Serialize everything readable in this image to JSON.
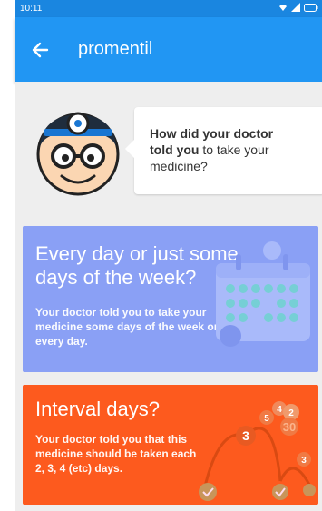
{
  "status_bar": {
    "time": "10:11"
  },
  "app_bar": {
    "title": "promentil",
    "back_icon": "arrow-back-icon"
  },
  "bubble": {
    "part1": "How did your doctor told you",
    "part2": " to take your medicine?"
  },
  "cards": [
    {
      "title": "Every day or just some days of the week?",
      "description": "Your doctor told you to take your medicine some days of the week or every day.",
      "color": "#8aa0f5"
    },
    {
      "title": "Interval days?",
      "description": "Your doctor told you that this medicine should be taken each 2, 3, 4 (etc) days.",
      "color": "#fd5a1e",
      "illustration_numbers": [
        "3",
        "5",
        "4",
        "2",
        "30",
        "3"
      ]
    }
  ],
  "colors": {
    "status_bar": "#1a86e0",
    "app_bar": "#2196f3",
    "background": "#eeeeee"
  }
}
